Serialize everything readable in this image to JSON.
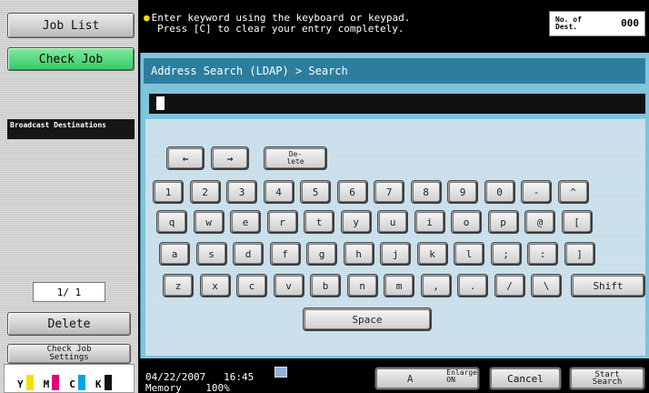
{
  "sidebar": {
    "job_list": "Job List",
    "check_job": "Check Job",
    "broadcast_title": "Broadcast Destinations",
    "page_counter": "1/ 1",
    "delete": "Delete",
    "check_job_settings": "Check Job Settings"
  },
  "toner": [
    {
      "label": "Y",
      "color": "#f2e200",
      "level": 0.8
    },
    {
      "label": "M",
      "color": "#e1007a",
      "level": 0.8
    },
    {
      "label": "C",
      "color": "#00a5de",
      "level": 0.8
    },
    {
      "label": "K",
      "color": "#111111",
      "level": 0.8
    }
  ],
  "top": {
    "message_line1": "Enter keyword using the keyboard or keypad.",
    "message_line2": "Press [C] to clear your entry completely.",
    "dest_label": "No. of Dest.",
    "dest_count": "000"
  },
  "panel": {
    "breadcrumb": "Address Search (LDAP) > Search",
    "entry_value": ""
  },
  "keyboard": {
    "left_arrow": "←",
    "right_arrow": "→",
    "delete": "De-\nlete",
    "row1": [
      "1",
      "2",
      "3",
      "4",
      "5",
      "6",
      "7",
      "8",
      "9",
      "0",
      "-",
      "^"
    ],
    "row2": [
      "q",
      "w",
      "e",
      "r",
      "t",
      "y",
      "u",
      "i",
      "o",
      "p",
      "@",
      "["
    ],
    "row3": [
      "a",
      "s",
      "d",
      "f",
      "g",
      "h",
      "j",
      "k",
      "l",
      ";",
      ":",
      "]"
    ],
    "row4": [
      "z",
      "x",
      "c",
      "v",
      "b",
      "n",
      "m",
      ",",
      ".",
      "/",
      "\\"
    ],
    "shift": "Shift",
    "space": "Space"
  },
  "footer": {
    "date": "04/22/2007",
    "time": "16:45",
    "memory_label": "Memory",
    "memory_value": "100%",
    "enlarge": "Enlarge ON",
    "cancel": "Cancel",
    "start_search": "Start Search"
  },
  "colors": {
    "header": "#2d7e9e",
    "panel": "#7fc4da",
    "check_job": "#38c86a"
  }
}
